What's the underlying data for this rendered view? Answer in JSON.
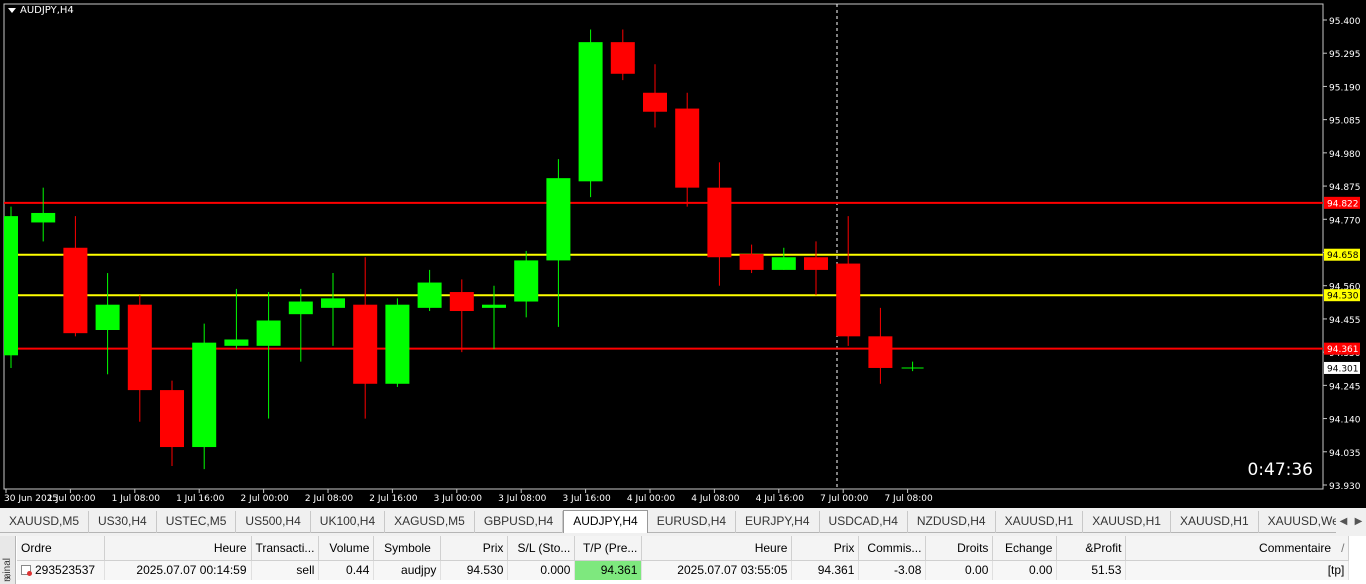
{
  "chart": {
    "title": "AUDJPY,H4",
    "countdown": "0:47:36",
    "price_axis": [
      "95.400",
      "95.295",
      "95.190",
      "95.085",
      "94.980",
      "94.875",
      "94.770",
      "94.665",
      "94.560",
      "94.455",
      "94.350",
      "94.245",
      "94.140",
      "94.035",
      "93.930"
    ],
    "time_axis": [
      "30 Jun 2025",
      "1 Jul 00:00",
      "1 Jul 08:00",
      "1 Jul 16:00",
      "2 Jul 00:00",
      "2 Jul 08:00",
      "2 Jul 16:00",
      "3 Jul 00:00",
      "3 Jul 08:00",
      "3 Jul 16:00",
      "4 Jul 00:00",
      "4 Jul 08:00",
      "4 Jul 16:00",
      "7 Jul 00:00",
      "7 Jul 08:00"
    ],
    "hlines": [
      {
        "price": 94.822,
        "label": "94.822",
        "color": "#ff0000"
      },
      {
        "price": 94.658,
        "label": "94.658",
        "color": "#ffff00"
      },
      {
        "price": 94.53,
        "label": "94.530",
        "color": "#ffff00"
      },
      {
        "price": 94.361,
        "label": "94.361",
        "color": "#ff0000"
      }
    ],
    "current_price": {
      "label": "94.301"
    },
    "colors": {
      "bull": "#00ff00",
      "bear": "#ff0000",
      "background": "#000000"
    }
  },
  "chart_data": {
    "type": "candlestick",
    "title": "AUDJPY,H4",
    "ylim": [
      93.93,
      95.4
    ],
    "candles": [
      {
        "o": 94.34,
        "h": 94.81,
        "l": 94.3,
        "c": 94.78
      },
      {
        "o": 94.76,
        "h": 94.87,
        "l": 94.7,
        "c": 94.79
      },
      {
        "o": 94.68,
        "h": 94.78,
        "l": 94.4,
        "c": 94.41
      },
      {
        "o": 94.42,
        "h": 94.6,
        "l": 94.28,
        "c": 94.5
      },
      {
        "o": 94.5,
        "h": 94.53,
        "l": 94.13,
        "c": 94.23
      },
      {
        "o": 94.23,
        "h": 94.26,
        "l": 93.99,
        "c": 94.05
      },
      {
        "o": 94.05,
        "h": 94.44,
        "l": 93.98,
        "c": 94.38
      },
      {
        "o": 94.37,
        "h": 94.55,
        "l": 94.36,
        "c": 94.39
      },
      {
        "o": 94.37,
        "h": 94.54,
        "l": 94.14,
        "c": 94.45
      },
      {
        "o": 94.47,
        "h": 94.55,
        "l": 94.32,
        "c": 94.51
      },
      {
        "o": 94.49,
        "h": 94.6,
        "l": 94.37,
        "c": 94.52
      },
      {
        "o": 94.5,
        "h": 94.65,
        "l": 94.14,
        "c": 94.25
      },
      {
        "o": 94.25,
        "h": 94.52,
        "l": 94.24,
        "c": 94.5
      },
      {
        "o": 94.49,
        "h": 94.61,
        "l": 94.48,
        "c": 94.57
      },
      {
        "o": 94.54,
        "h": 94.58,
        "l": 94.35,
        "c": 94.48
      },
      {
        "o": 94.49,
        "h": 94.56,
        "l": 94.36,
        "c": 94.5
      },
      {
        "o": 94.51,
        "h": 94.67,
        "l": 94.46,
        "c": 94.64
      },
      {
        "o": 94.64,
        "h": 94.96,
        "l": 94.43,
        "c": 94.9
      },
      {
        "o": 94.89,
        "h": 95.37,
        "l": 94.84,
        "c": 95.33
      },
      {
        "o": 95.33,
        "h": 95.37,
        "l": 95.21,
        "c": 95.23
      },
      {
        "o": 95.17,
        "h": 95.26,
        "l": 95.06,
        "c": 95.11
      },
      {
        "o": 95.12,
        "h": 95.17,
        "l": 94.81,
        "c": 94.87
      },
      {
        "o": 94.87,
        "h": 94.95,
        "l": 94.56,
        "c": 94.65
      },
      {
        "o": 94.66,
        "h": 94.69,
        "l": 94.6,
        "c": 94.61
      },
      {
        "o": 94.61,
        "h": 94.68,
        "l": 94.61,
        "c": 94.65
      },
      {
        "o": 94.65,
        "h": 94.7,
        "l": 94.53,
        "c": 94.61
      },
      {
        "o": 94.63,
        "h": 94.78,
        "l": 94.37,
        "c": 94.4
      },
      {
        "o": 94.4,
        "h": 94.49,
        "l": 94.25,
        "c": 94.3
      },
      {
        "o": 94.3,
        "h": 94.32,
        "l": 94.29,
        "c": 94.3
      }
    ]
  },
  "tabs": [
    {
      "label": "XAUUSD,M5"
    },
    {
      "label": "US30,H4"
    },
    {
      "label": "USTEC,M5"
    },
    {
      "label": "US500,H4"
    },
    {
      "label": "UK100,H4"
    },
    {
      "label": "XAGUSD,M5"
    },
    {
      "label": "GBPUSD,H4"
    },
    {
      "label": "AUDJPY,H4",
      "active": true
    },
    {
      "label": "EURUSD,H4"
    },
    {
      "label": "EURJPY,H4"
    },
    {
      "label": "USDCAD,H4"
    },
    {
      "label": "NZDUSD,H4"
    },
    {
      "label": "XAUUSD,H1"
    },
    {
      "label": "XAUUSD,H1"
    },
    {
      "label": "XAUUSD,H1"
    },
    {
      "label": "XAUUSD,Weekly"
    }
  ],
  "terminal": {
    "side_label": "minal",
    "columns": [
      "Ordre",
      "Heure",
      "Transacti...",
      "Volume",
      "Symbole",
      "Prix",
      "S/L (Sto...",
      "T/P (Pre...",
      "Heure",
      "Prix",
      "Commis...",
      "Droits",
      "Echange",
      "&Profit",
      "Commentaire"
    ],
    "sort_marker": "/",
    "row": [
      "293523537",
      "2025.07.07 00:14:59",
      "sell",
      "0.44",
      "audjpy",
      "94.530",
      "0.000",
      "94.361",
      "2025.07.07 03:55:05",
      "94.361",
      "-3.08",
      "0.00",
      "0.00",
      "51.53",
      "[tp]"
    ]
  }
}
